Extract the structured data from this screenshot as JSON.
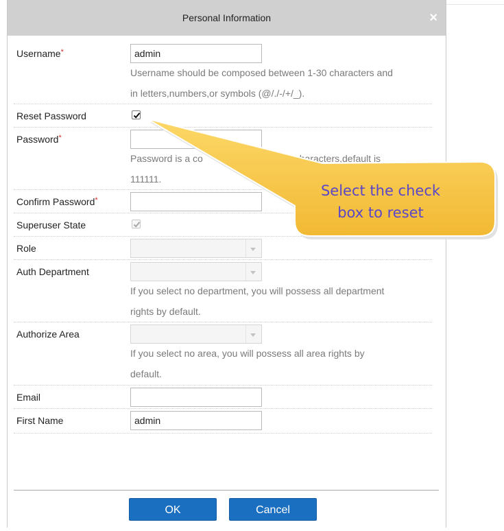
{
  "dialog": {
    "title": "Personal Information",
    "close_glyph": "×"
  },
  "fields": {
    "username": {
      "label": "Username",
      "required_mark": "*",
      "value": "admin",
      "hint_line1": "Username should be composed between 1-30 characters and",
      "hint_line2": "in letters,numbers,or symbols (@/./-/+/_)."
    },
    "reset_password": {
      "label": "Reset Password",
      "checked": true
    },
    "password": {
      "label": "Password",
      "required_mark": "*",
      "value": "",
      "hint_line1": "Password is a co",
      "hint_line1b": "n of 4 to 18 characters,default is",
      "hint_line2": "111111."
    },
    "confirm_password": {
      "label": "Confirm Password",
      "required_mark": "*",
      "value": ""
    },
    "superuser_state": {
      "label": "Superuser State",
      "checked": true,
      "disabled": true
    },
    "role": {
      "label": "Role",
      "value": ""
    },
    "auth_department": {
      "label": "Auth Department",
      "value": "",
      "hint_line1": "If you select no department, you will possess all department",
      "hint_line2": "rights by default."
    },
    "authorize_area": {
      "label": "Authorize Area",
      "value": "",
      "hint_line1": "If you select no area, you will possess all area rights by",
      "hint_line2": "default."
    },
    "email": {
      "label": "Email",
      "value": ""
    },
    "first_name": {
      "label": "First Name",
      "value": "admin"
    }
  },
  "buttons": {
    "ok": "OK",
    "cancel": "Cancel"
  },
  "callout": {
    "line1": "Select the check",
    "line2": "box to reset",
    "fill_color": "#f7c948",
    "text_color": "#5a46c8"
  },
  "colors": {
    "button": "#1b6fc1",
    "titlebar": "#d0d0d0",
    "required": "#d62a2a"
  }
}
